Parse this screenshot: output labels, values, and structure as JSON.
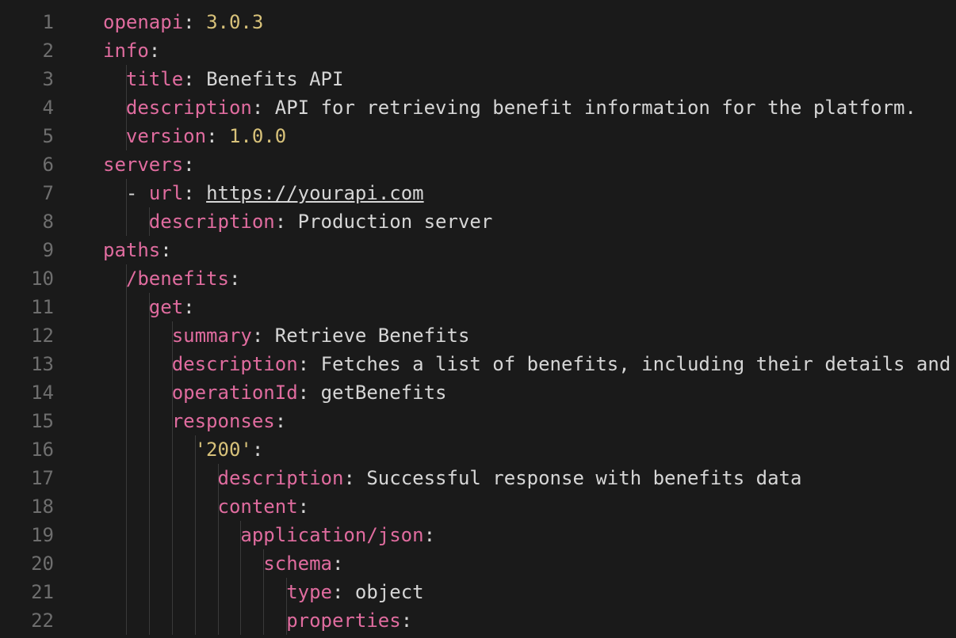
{
  "lines": [
    {
      "num": 1,
      "indent": 0,
      "tokens": [
        [
          "k",
          "openapi"
        ],
        [
          "p",
          ": "
        ],
        [
          "n",
          "3.0.3"
        ]
      ]
    },
    {
      "num": 2,
      "indent": 0,
      "tokens": [
        [
          "k",
          "info"
        ],
        [
          "p",
          ":"
        ]
      ]
    },
    {
      "num": 3,
      "indent": 1,
      "tokens": [
        [
          "k",
          "title"
        ],
        [
          "p",
          ": "
        ],
        [
          "s",
          "Benefits API"
        ]
      ]
    },
    {
      "num": 4,
      "indent": 1,
      "tokens": [
        [
          "k",
          "description"
        ],
        [
          "p",
          ": "
        ],
        [
          "s",
          "API for retrieving benefit information for the platform."
        ]
      ]
    },
    {
      "num": 5,
      "indent": 1,
      "tokens": [
        [
          "k",
          "version"
        ],
        [
          "p",
          ": "
        ],
        [
          "n",
          "1.0.0"
        ]
      ]
    },
    {
      "num": 6,
      "indent": 0,
      "tokens": [
        [
          "k",
          "servers"
        ],
        [
          "p",
          ":"
        ]
      ]
    },
    {
      "num": 7,
      "indent": 1,
      "tokens": [
        [
          "dash",
          "- "
        ],
        [
          "k",
          "url"
        ],
        [
          "p",
          ": "
        ],
        [
          "lnk",
          "https://yourapi.com"
        ]
      ]
    },
    {
      "num": 8,
      "indent": 2,
      "tokens": [
        [
          "k",
          "description"
        ],
        [
          "p",
          ": "
        ],
        [
          "s",
          "Production server"
        ]
      ]
    },
    {
      "num": 9,
      "indent": 0,
      "tokens": [
        [
          "k",
          "paths"
        ],
        [
          "p",
          ":"
        ]
      ]
    },
    {
      "num": 10,
      "indent": 1,
      "tokens": [
        [
          "k",
          "/benefits"
        ],
        [
          "p",
          ":"
        ]
      ]
    },
    {
      "num": 11,
      "indent": 2,
      "tokens": [
        [
          "k",
          "get"
        ],
        [
          "p",
          ":"
        ]
      ]
    },
    {
      "num": 12,
      "indent": 3,
      "tokens": [
        [
          "k",
          "summary"
        ],
        [
          "p",
          ": "
        ],
        [
          "s",
          "Retrieve Benefits"
        ]
      ]
    },
    {
      "num": 13,
      "indent": 3,
      "tokens": [
        [
          "k",
          "description"
        ],
        [
          "p",
          ": "
        ],
        [
          "s",
          "Fetches a list of benefits, including their details and "
        ]
      ]
    },
    {
      "num": 14,
      "indent": 3,
      "tokens": [
        [
          "k",
          "operationId"
        ],
        [
          "p",
          ": "
        ],
        [
          "s",
          "getBenefits"
        ]
      ]
    },
    {
      "num": 15,
      "indent": 3,
      "tokens": [
        [
          "k",
          "responses"
        ],
        [
          "p",
          ":"
        ]
      ]
    },
    {
      "num": 16,
      "indent": 4,
      "tokens": [
        [
          "sq",
          "'200'"
        ],
        [
          "p",
          ":"
        ]
      ]
    },
    {
      "num": 17,
      "indent": 5,
      "tokens": [
        [
          "k",
          "description"
        ],
        [
          "p",
          ": "
        ],
        [
          "s",
          "Successful response with benefits data"
        ]
      ]
    },
    {
      "num": 18,
      "indent": 5,
      "tokens": [
        [
          "k",
          "content"
        ],
        [
          "p",
          ":"
        ]
      ]
    },
    {
      "num": 19,
      "indent": 6,
      "tokens": [
        [
          "k",
          "application/json"
        ],
        [
          "p",
          ":"
        ]
      ]
    },
    {
      "num": 20,
      "indent": 7,
      "tokens": [
        [
          "k",
          "schema"
        ],
        [
          "p",
          ":"
        ]
      ]
    },
    {
      "num": 21,
      "indent": 8,
      "tokens": [
        [
          "k",
          "type"
        ],
        [
          "p",
          ": "
        ],
        [
          "s",
          "object"
        ]
      ]
    },
    {
      "num": 22,
      "indent": 8,
      "tokens": [
        [
          "k",
          "properties"
        ],
        [
          "p",
          ":"
        ]
      ]
    }
  ],
  "indentWidth": 2,
  "charWidth": 14.45,
  "baseX": 36
}
